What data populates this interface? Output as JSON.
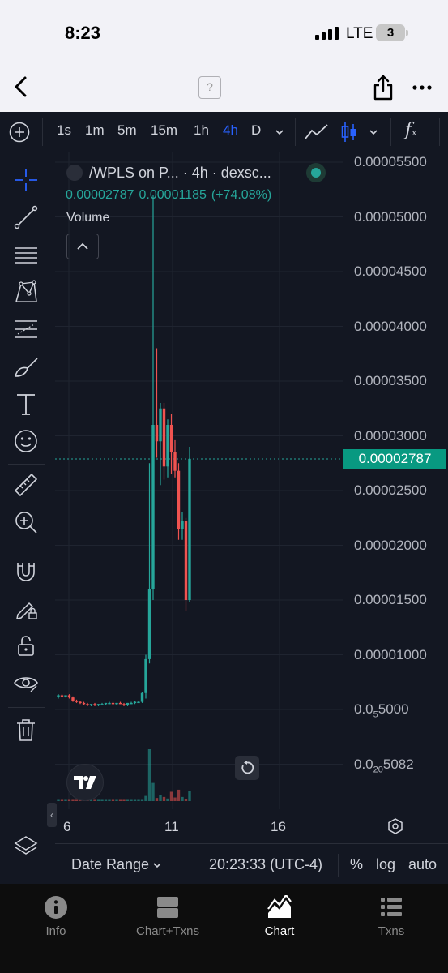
{
  "status_bar": {
    "time": "8:23",
    "network": "LTE",
    "battery": "3"
  },
  "browser": {
    "site_icon": "?"
  },
  "toolbar": {
    "intervals": [
      "1s",
      "1m",
      "5m",
      "15m",
      "1h",
      "4h",
      "D"
    ],
    "active_interval": "4h",
    "function_icon": "f"
  },
  "legend": {
    "title": "/WPLS on P... · 4h · dexsc...",
    "last_price": "0.00002787",
    "change": "0.00001185",
    "change_pct": "(+74.08%)",
    "volume_label": "Volume"
  },
  "price_axis": {
    "labels": [
      "0.00005500",
      "0.00005000",
      "0.00004500",
      "0.00004000",
      "0.00003500",
      "0.00003000",
      "0.00002500",
      "0.00002000",
      "0.00001500",
      "0.00001000"
    ],
    "subscript_labels": [
      {
        "prefix": "0.0",
        "sub": "5",
        "suffix": "5000"
      },
      {
        "prefix": "0.0",
        "sub": "20",
        "suffix": "5082"
      }
    ],
    "last_price_tag": "0.00002787"
  },
  "time_axis": {
    "labels": [
      "6",
      "11",
      "16"
    ]
  },
  "bottom_bar": {
    "date_range": "Date Range",
    "clock": "20:23:33 (UTC-4)",
    "percent": "%",
    "log": "log",
    "auto": "auto"
  },
  "tabs": [
    {
      "label": "Info",
      "icon": "info-icon"
    },
    {
      "label": "Chart+Txns",
      "icon": "split-view-icon"
    },
    {
      "label": "Chart",
      "icon": "chart-icon"
    },
    {
      "label": "Txns",
      "icon": "list-icon"
    }
  ],
  "active_tab": "Chart",
  "colors": {
    "up": "#26a69a",
    "down": "#ef5350",
    "accent": "#2962ff",
    "background": "#131722"
  },
  "chart_data": {
    "type": "candlestick",
    "interval": "4h",
    "y_range": [
      2e-06,
      5.6e-05
    ],
    "x_ticks": [
      "6",
      "11",
      "16"
    ],
    "last_price": 2.787e-05,
    "candles": [
      {
        "o": 6.2e-06,
        "h": 6.4e-06,
        "l": 6e-06,
        "c": 6.3e-06
      },
      {
        "o": 6.3e-06,
        "h": 6.4e-06,
        "l": 6.1e-06,
        "c": 6.2e-06
      },
      {
        "o": 6.2e-06,
        "h": 6.3e-06,
        "l": 6.1e-06,
        "c": 6.3e-06
      },
      {
        "o": 6.3e-06,
        "h": 6.4e-06,
        "l": 6e-06,
        "c": 6.1e-06
      },
      {
        "o": 6.1e-06,
        "h": 6.2e-06,
        "l": 5.7e-06,
        "c": 5.8e-06
      },
      {
        "o": 5.8e-06,
        "h": 5.9e-06,
        "l": 5.6e-06,
        "c": 5.7e-06
      },
      {
        "o": 5.7e-06,
        "h": 5.8e-06,
        "l": 5.5e-06,
        "c": 5.6e-06
      },
      {
        "o": 5.6e-06,
        "h": 5.7e-06,
        "l": 5.4e-06,
        "c": 5.5e-06
      },
      {
        "o": 5.5e-06,
        "h": 5.6e-06,
        "l": 5.3e-06,
        "c": 5.4e-06
      },
      {
        "o": 5.4e-06,
        "h": 5.5e-06,
        "l": 5.3e-06,
        "c": 5.5e-06
      },
      {
        "o": 5.5e-06,
        "h": 5.6e-06,
        "l": 5.3e-06,
        "c": 5.4e-06
      },
      {
        "o": 5.4e-06,
        "h": 5.5e-06,
        "l": 5.3e-06,
        "c": 5.5e-06
      },
      {
        "o": 5.5e-06,
        "h": 5.6e-06,
        "l": 5.4e-06,
        "c": 5.5e-06
      },
      {
        "o": 5.5e-06,
        "h": 5.6e-06,
        "l": 5.4e-06,
        "c": 5.6e-06
      },
      {
        "o": 5.6e-06,
        "h": 5.7e-06,
        "l": 5.5e-06,
        "c": 5.6e-06
      },
      {
        "o": 5.6e-06,
        "h": 5.7e-06,
        "l": 5.4e-06,
        "c": 5.5e-06
      },
      {
        "o": 5.5e-06,
        "h": 5.6e-06,
        "l": 5.4e-06,
        "c": 5.6e-06
      },
      {
        "o": 5.6e-06,
        "h": 5.7e-06,
        "l": 5.5e-06,
        "c": 5.5e-06
      },
      {
        "o": 5.5e-06,
        "h": 5.6e-06,
        "l": 5.3e-06,
        "c": 5.4e-06
      },
      {
        "o": 5.4e-06,
        "h": 5.6e-06,
        "l": 5.3e-06,
        "c": 5.6e-06
      },
      {
        "o": 5.6e-06,
        "h": 5.7e-06,
        "l": 5.5e-06,
        "c": 5.6e-06
      },
      {
        "o": 5.6e-06,
        "h": 5.8e-06,
        "l": 5.5e-06,
        "c": 5.7e-06
      },
      {
        "o": 5.7e-06,
        "h": 5.8e-06,
        "l": 5.6e-06,
        "c": 5.7e-06
      },
      {
        "o": 5.7e-06,
        "h": 6.6e-06,
        "l": 5.6e-06,
        "c": 6.5e-06
      },
      {
        "o": 6.5e-06,
        "h": 1e-05,
        "l": 6e-06,
        "c": 9.6e-06
      },
      {
        "o": 9.6e-06,
        "h": 2.75e-05,
        "l": 9.2e-06,
        "c": 1.6e-05
      },
      {
        "o": 1.6e-05,
        "h": 5.2e-05,
        "l": 1.5e-05,
        "c": 3.1e-05
      },
      {
        "o": 3.1e-05,
        "h": 3.8e-05,
        "l": 2.8e-05,
        "c": 2.95e-05
      },
      {
        "o": 2.95e-05,
        "h": 3.3e-05,
        "l": 2.55e-05,
        "c": 3.25e-05
      },
      {
        "o": 3.25e-05,
        "h": 3.3e-05,
        "l": 2.6e-05,
        "c": 2.72e-05
      },
      {
        "o": 2.72e-05,
        "h": 3.15e-05,
        "l": 2.62e-05,
        "c": 3.1e-05
      },
      {
        "o": 3.1e-05,
        "h": 3.2e-05,
        "l": 2.65e-05,
        "c": 2.85e-05
      },
      {
        "o": 2.85e-05,
        "h": 2.96e-05,
        "l": 2.62e-05,
        "c": 2.68e-05
      },
      {
        "o": 2.68e-05,
        "h": 2.75e-05,
        "l": 2.05e-05,
        "c": 2.15e-05
      },
      {
        "o": 2.15e-05,
        "h": 2.3e-05,
        "l": 2.05e-05,
        "c": 2.22e-05
      },
      {
        "o": 2.22e-05,
        "h": 2.25e-05,
        "l": 1.4e-05,
        "c": 1.5e-05
      },
      {
        "o": 1.5e-05,
        "h": 2.9e-05,
        "l": 1.48e-05,
        "c": 2.79e-05
      }
    ],
    "volume": [
      1,
      1,
      1,
      1,
      1,
      1,
      1,
      1,
      1,
      1,
      1,
      1,
      1,
      1,
      1,
      1,
      1,
      1,
      1,
      1,
      1,
      1,
      1,
      2,
      10,
      100,
      35,
      6,
      12,
      8,
      5,
      18,
      7,
      22,
      8,
      4,
      20
    ]
  }
}
